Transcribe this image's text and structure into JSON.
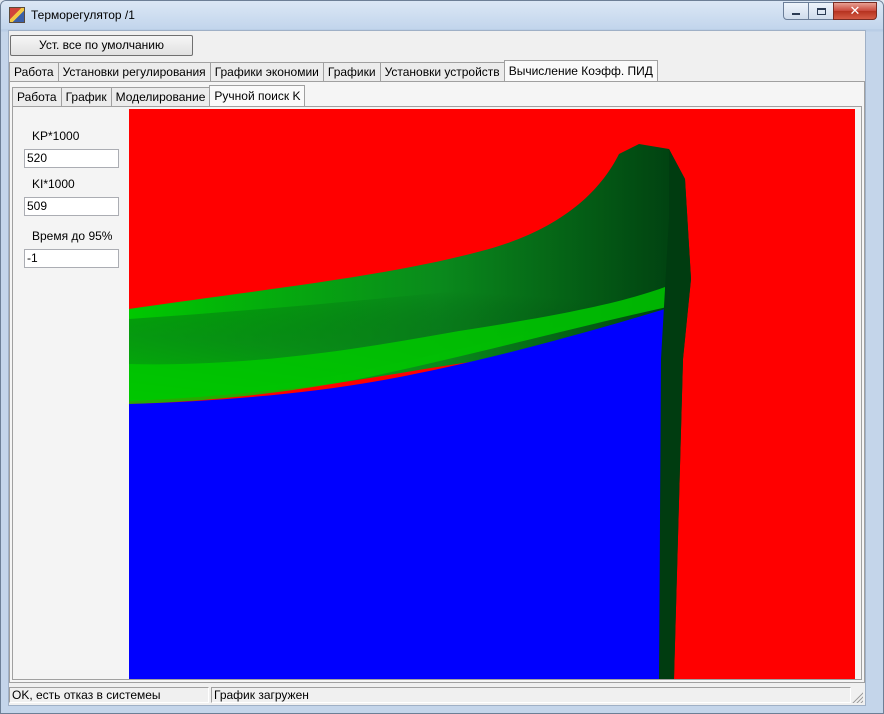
{
  "window": {
    "title": "Терморегулятор /1"
  },
  "toolbar": {
    "defaults_label": "Уст. все по умолчанию"
  },
  "main_tabs": [
    {
      "label": "Работа",
      "active": false
    },
    {
      "label": "Установки регулирования",
      "active": false
    },
    {
      "label": "Графики экономии",
      "active": false
    },
    {
      "label": "Графики",
      "active": false
    },
    {
      "label": "Установки устройств",
      "active": false
    },
    {
      "label": "Вычисление Коэфф. ПИД",
      "active": true
    }
  ],
  "sub_tabs": [
    {
      "label": "Работа",
      "active": false
    },
    {
      "label": "График",
      "active": false
    },
    {
      "label": "Моделирование",
      "active": false
    },
    {
      "label": "Ручной поиск K",
      "active": true
    }
  ],
  "fields": {
    "kp": {
      "label": "KP*1000",
      "value": "520"
    },
    "ki": {
      "label": "KI*1000",
      "value": "509"
    },
    "time95": {
      "label": "Время до 95%",
      "value": "-1"
    }
  },
  "plot": {
    "colors": {
      "unstable": "#ff0000",
      "good_light": "#00c800",
      "good_dark": "#003c10",
      "slow": "#0000ff"
    }
  },
  "status": {
    "left": "OK, есть отказ в системеы",
    "right": "График загружен"
  }
}
